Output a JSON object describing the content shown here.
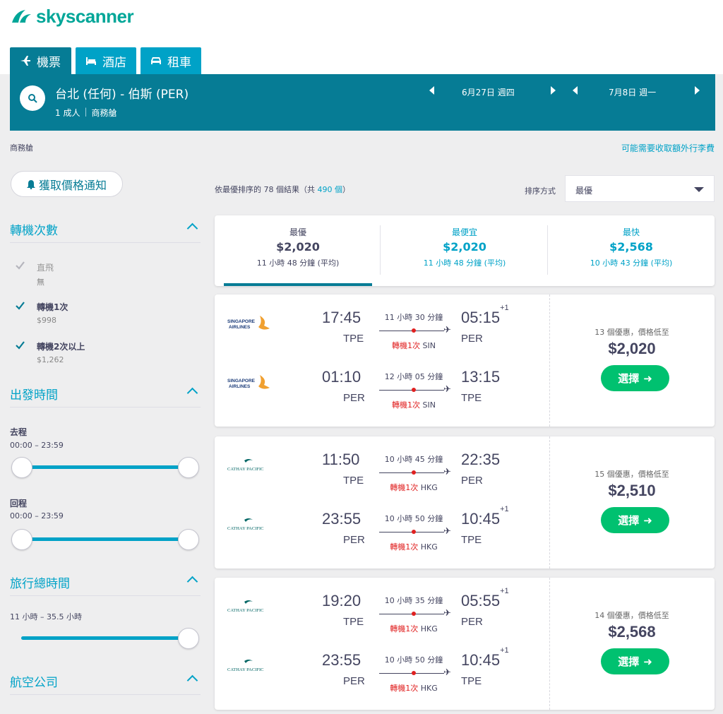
{
  "brand": {
    "name": "skyscanner",
    "color": "#00a698"
  },
  "tabs": [
    {
      "label": "機票",
      "icon": "plane-icon"
    },
    {
      "label": "酒店",
      "icon": "bed-icon"
    },
    {
      "label": "租車",
      "icon": "car-icon"
    }
  ],
  "search": {
    "route": "台北 (任何) - 伯斯 (PER)",
    "passengers": "1 成人",
    "cabin": "商務艙",
    "depart_date": "6月27日 週四",
    "return_date": "7月8日 週一"
  },
  "subheader": {
    "cabin_note": "商務艙",
    "fees_link": "可能需要收取額外行李費"
  },
  "alert_button": "獲取價格通知",
  "filters": {
    "stops": {
      "title": "轉機次數",
      "options": [
        {
          "label": "直飛",
          "sub": "無",
          "checked": true,
          "disabled": true
        },
        {
          "label": "轉機1次",
          "sub": "$998",
          "checked": true,
          "disabled": false
        },
        {
          "label": "轉機2次以上",
          "sub": "$1,262",
          "checked": true,
          "disabled": false
        }
      ]
    },
    "times": {
      "title": "出發時間",
      "outbound_label": "去程",
      "outbound_range": "00:00 – 23:59",
      "return_label": "回程",
      "return_range": "00:00 – 23:59"
    },
    "duration": {
      "title": "旅行總時間",
      "range": "11 小時 – 35.5 小時"
    },
    "airlines": {
      "title": "航空公司"
    }
  },
  "results": {
    "prefix": "依最優排序的",
    "count_text": " 78 個結果（共 ",
    "total_link": "490 個",
    "suffix": "）",
    "sort_label": "排序方式",
    "sort_value": "最優"
  },
  "sort_tabs": [
    {
      "title": "最優",
      "price": "$2,020",
      "duration": "11 小時 48 分鐘 (平均)"
    },
    {
      "title": "最便宜",
      "price": "$2,020",
      "duration": "11 小時 48 分鐘 (平均)"
    },
    {
      "title": "最快",
      "price": "$2,568",
      "duration": "10 小時 43 分鐘 (平均)"
    }
  ],
  "itineraries": [
    {
      "airline": "SINGAPORE AIRLINES",
      "deals": "13 個優惠，價格低至",
      "price": "$2,020",
      "select": "選擇",
      "legs": [
        {
          "dep": "17:45",
          "dep_code": "TPE",
          "arr": "05:15",
          "arr_plus": "+1",
          "arr_code": "PER",
          "duration": "11 小時 30 分鐘",
          "stops": "轉機1次",
          "via": "SIN"
        },
        {
          "dep": "01:10",
          "dep_code": "PER",
          "arr": "13:15",
          "arr_plus": "",
          "arr_code": "TPE",
          "duration": "12 小時 05 分鐘",
          "stops": "轉機1次",
          "via": "SIN"
        }
      ]
    },
    {
      "airline": "CATHAY PACIFIC",
      "deals": "15 個優惠，價格低至",
      "price": "$2,510",
      "select": "選擇",
      "legs": [
        {
          "dep": "11:50",
          "dep_code": "TPE",
          "arr": "22:35",
          "arr_plus": "",
          "arr_code": "PER",
          "duration": "10 小時 45 分鐘",
          "stops": "轉機1次",
          "via": "HKG"
        },
        {
          "dep": "23:55",
          "dep_code": "PER",
          "arr": "10:45",
          "arr_plus": "+1",
          "arr_code": "TPE",
          "duration": "10 小時 50 分鐘",
          "stops": "轉機1次",
          "via": "HKG"
        }
      ]
    },
    {
      "airline": "CATHAY PACIFIC",
      "deals": "14 個優惠，價格低至",
      "price": "$2,568",
      "select": "選擇",
      "legs": [
        {
          "dep": "19:20",
          "dep_code": "TPE",
          "arr": "05:55",
          "arr_plus": "+1",
          "arr_code": "PER",
          "duration": "10 小時 35 分鐘",
          "stops": "轉機1次",
          "via": "HKG"
        },
        {
          "dep": "23:55",
          "dep_code": "PER",
          "arr": "10:45",
          "arr_plus": "+1",
          "arr_code": "TPE",
          "duration": "10 小時 50 分鐘",
          "stops": "轉機1次",
          "via": "HKG"
        }
      ]
    }
  ],
  "colors": {
    "primary": "#067c95",
    "accent": "#00a2c7",
    "select": "#00c170",
    "stop_red": "#e02020"
  }
}
